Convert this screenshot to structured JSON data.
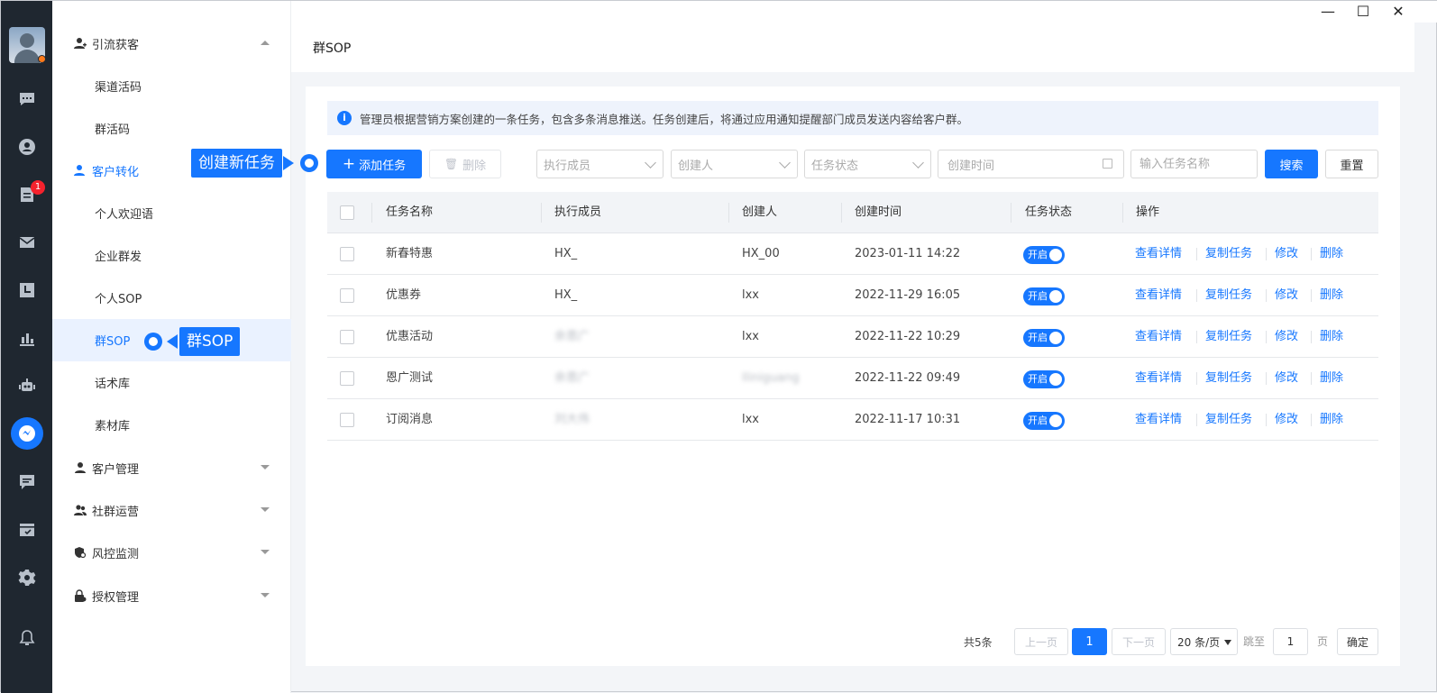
{
  "window": {
    "minimize": "—",
    "maximize": "☐",
    "close": "✕"
  },
  "rail": {
    "badge_count": "1",
    "icons": [
      "chat-icon",
      "contacts-icon",
      "document-icon",
      "mail-icon",
      "calendar-icon",
      "chart-icon",
      "robot-icon",
      "wechat-work-icon",
      "message-icon",
      "table-icon",
      "settings-icon",
      "bell-icon"
    ]
  },
  "menu": {
    "group_lead": "引流获客",
    "item_channel": "渠道活码",
    "item_group_code": "群活码",
    "group_convert": "客户转化",
    "item_welcome": "个人欢迎语",
    "item_broadcast": "企业群发",
    "item_personal_sop": "个人SOP",
    "item_group_sop": "群SOP",
    "item_script": "话术库",
    "item_material": "素材库",
    "group_customer": "客户管理",
    "group_community": "社群运营",
    "group_risk": "风控监测",
    "group_auth": "授权管理"
  },
  "callouts": {
    "new_task": "创建新任务",
    "group_sop": "群SOP"
  },
  "page": {
    "title": "群SOP",
    "notice": "管理员根据营销方案创建的一条任务，包含多条消息推送。任务创建后，将通过应用通知提醒部门成员发送内容给客户群。"
  },
  "toolbar": {
    "add_label": "添加任务",
    "delete_label": "删除",
    "executor_placeholder": "执行成员",
    "creator_placeholder": "创建人",
    "status_placeholder": "任务状态",
    "created_time_placeholder": "创建时间",
    "search_placeholder": "输入任务名称",
    "search_label": "搜索",
    "reset_label": "重置"
  },
  "table": {
    "headers": {
      "name": "任务名称",
      "executor": "执行成员",
      "creator": "创建人",
      "created_at": "创建时间",
      "status": "任务状态",
      "actions": "操作"
    },
    "rows": [
      {
        "name": "新春特惠",
        "executor": "HX_",
        "creator": "HX_00",
        "created_at": "2023-01-11 14:22",
        "status": "开启"
      },
      {
        "name": "优惠券",
        "executor": "HX_",
        "creator": "lxx",
        "created_at": "2022-11-29 16:05",
        "status": "开启"
      },
      {
        "name": "优惠活动",
        "executor": "余恩广",
        "creator": "lxx",
        "created_at": "2022-11-22 10:29",
        "status": "开启"
      },
      {
        "name": "恩广测试",
        "executor": "余恩广",
        "creator": "lliniguang",
        "created_at": "2022-11-22 09:49",
        "status": "开启"
      },
      {
        "name": "订阅消息",
        "executor": "刘大伟",
        "creator": "lxx",
        "created_at": "2022-11-17 10:31",
        "status": "开启"
      }
    ],
    "actions": {
      "view": "查看详情",
      "copy": "复制任务",
      "edit": "修改",
      "delete": "删除"
    }
  },
  "pagination": {
    "total": "共5条",
    "prev": "上一页",
    "current": "1",
    "next": "下一页",
    "page_size": "20 条/页",
    "jump_label": "跳至",
    "jump_value": "1",
    "page_unit": "页",
    "confirm": "确定"
  },
  "colors": {
    "accent": "#1677ff",
    "rail_bg": "#1f2730",
    "badge": "#f5222d"
  }
}
